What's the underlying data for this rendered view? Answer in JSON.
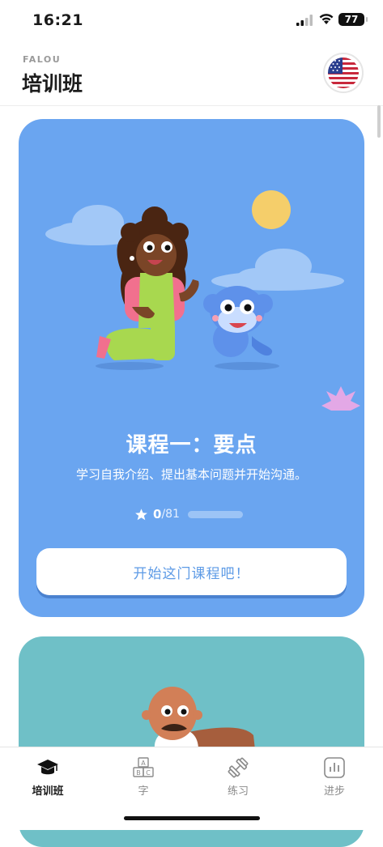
{
  "status_bar": {
    "time": "16:21",
    "battery": "77"
  },
  "header": {
    "overline": "FALOU",
    "title": "培训班",
    "flag_icon": "us-flag-icon"
  },
  "course": {
    "title": "课程一：要点",
    "subtitle": "学习自我介绍、提出基本问题并开始沟通。",
    "progress_done": "0",
    "progress_total": "/81",
    "progress_fraction": 0,
    "button_label": "开始这门课程吧！",
    "card_color": "#6aa5f0"
  },
  "next_course": {
    "card_color": "#6fc0c7"
  },
  "tabs": [
    {
      "label": "培训班",
      "icon": "graduation-cap-icon",
      "active": true
    },
    {
      "label": "字",
      "icon": "abc-blocks-icon",
      "active": false
    },
    {
      "label": "练习",
      "icon": "dumbbell-icon",
      "active": false
    },
    {
      "label": "进步",
      "icon": "bar-chart-icon",
      "active": false
    }
  ]
}
